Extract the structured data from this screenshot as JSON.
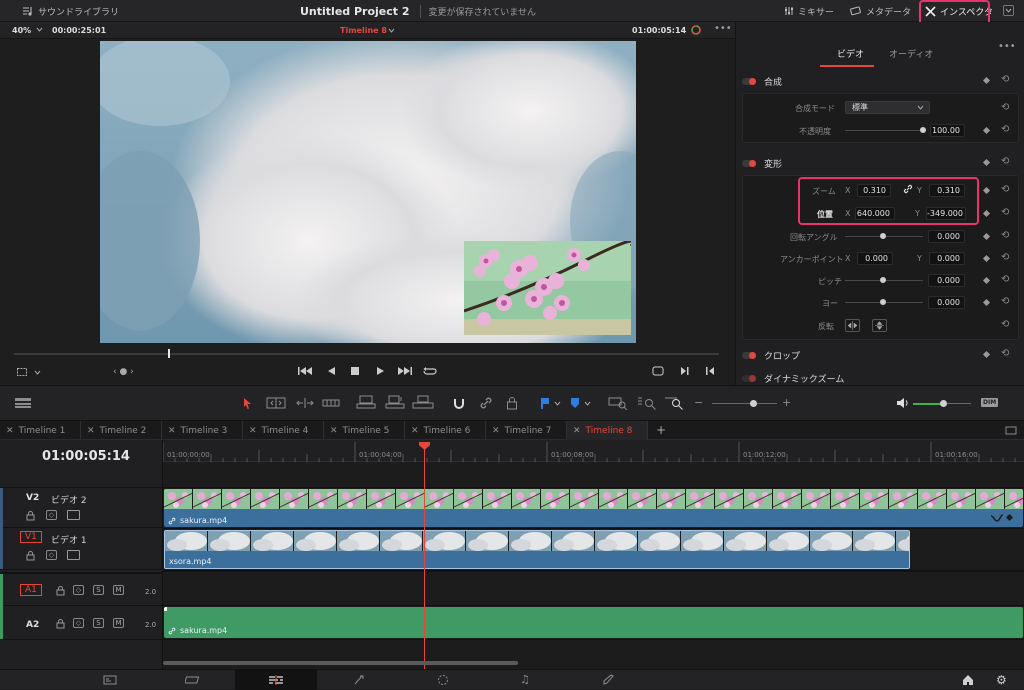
{
  "topbar": {
    "sound_library": "サウンドライブラリ",
    "project_title": "Untitled Project 2",
    "save_status": "変更が保存されていません",
    "mixer": "ミキサー",
    "metadata": "メタデータ",
    "inspector": "インスペクタ"
  },
  "viewer": {
    "zoom": "40%",
    "source_timecode": "00:00:25:01",
    "timeline_name": "Timeline 8",
    "record_timecode": "01:00:05:14"
  },
  "inspector": {
    "tabs": [
      "ビデオ",
      "オーディオ"
    ],
    "composite": {
      "title": "合成",
      "blend_mode_label": "合成モード",
      "blend_mode_value": "標準",
      "opacity_label": "不透明度",
      "opacity_value": "100.00"
    },
    "transform": {
      "title": "変形",
      "zoom_label": "ズーム",
      "zoom_x": "0.310",
      "zoom_y": "0.310",
      "position_label": "位置",
      "position_x": "640.000",
      "position_y": "-349.000",
      "rotation_label": "回転アングル",
      "rotation_value": "0.000",
      "anchor_label": "アンカーポイント",
      "anchor_x": "0.000",
      "anchor_y": "0.000",
      "pitch_label": "ピッチ",
      "pitch_value": "0.000",
      "yaw_label": "ヨー",
      "yaw_value": "0.000",
      "flip_label": "反転",
      "x_letter": "X",
      "y_letter": "Y"
    },
    "crop_title": "クロップ",
    "dynamic_zoom_title": "ダイナミックズーム"
  },
  "tabs": [
    "Timeline 1",
    "Timeline 2",
    "Timeline 3",
    "Timeline 4",
    "Timeline 5",
    "Timeline 6",
    "Timeline 7",
    "Timeline 8"
  ],
  "timeline": {
    "timecode": "01:00:05:14",
    "ruler": [
      "01:00:00:00",
      "01:00:04:00",
      "01:00:08:00",
      "01:00:12:00",
      "01:00:16:00"
    ],
    "tracks": {
      "v2_label": "V2",
      "v2_name": "ビデオ 2",
      "v1_label": "V1",
      "v1_name": "ビデオ 1",
      "a1_label": "A1",
      "a2_label": "A2",
      "a1_level": "2.0",
      "a2_level": "2.0",
      "s": "S",
      "m": "M"
    },
    "clips": {
      "v2_clip": "sakura.mp4",
      "v1_clip": "xsora.mp4",
      "a2_clip": "sakura.mp4"
    }
  },
  "colors": {
    "accent_red": "#e5473f",
    "highlight_pink": "#e8336b",
    "video_clip": "#3d6f9c",
    "audio_clip": "#3f9a63"
  }
}
